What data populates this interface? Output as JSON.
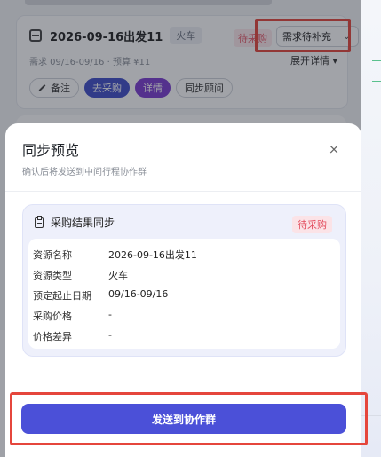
{
  "background_card": {
    "trip_title": "2026-09-16出发11",
    "transport_tag": "火车",
    "status_tag": "待采购",
    "need_select_value": "需求待补充",
    "meta": "需求 09/16-09/16 · 预算 ¥11",
    "expand_label": "展开详情 ▾",
    "actions": {
      "note": "备注",
      "purchase": "去采购",
      "detail": "详情",
      "sync_advisor": "同步顾问"
    }
  },
  "sheet": {
    "title": "同步预览",
    "subtitle": "确认后将发送到中间行程协作群",
    "close_glyph": "×",
    "result_card": {
      "heading": "采购结果同步",
      "status": "待采购",
      "rows": [
        {
          "key": "资源名称",
          "value": "2026-09-16出发11"
        },
        {
          "key": "资源类型",
          "value": "火车"
        },
        {
          "key": "预定起止日期",
          "value": "09/16-09/16"
        },
        {
          "key": "采购价格",
          "value": "-"
        },
        {
          "key": "价格差异",
          "value": "-"
        }
      ]
    },
    "send_button": "发送到协作群"
  },
  "icons": {
    "train": "train-icon",
    "clipboard": "clipboard-icon",
    "close": "close-icon",
    "edit": "edit-icon",
    "chevron": "chevron-down-icon"
  },
  "colors": {
    "primary": "#4b50d8",
    "status_red": "#e34b5c",
    "highlight_box": "#e5463c"
  }
}
